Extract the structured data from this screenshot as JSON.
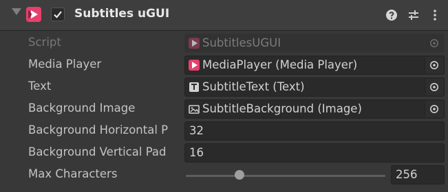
{
  "component": {
    "title": "Subtitles uGUI",
    "enabled": true,
    "icons": {
      "component": "avpro-play-icon",
      "help": "help-icon",
      "presets": "presets-sliders-icon",
      "menu": "kebab-menu-icon"
    },
    "colors": {
      "brand": "#e73f6c",
      "accent": "#e8e8e8"
    }
  },
  "fields": {
    "script": {
      "label": "Script",
      "value": "SubtitlesUGUI",
      "icon": "script-icon"
    },
    "media_player": {
      "label": "Media Player",
      "value": "MediaPlayer (Media Player)",
      "icon": "avpro-play-icon"
    },
    "text": {
      "label": "Text",
      "value": "SubtitleText (Text)",
      "icon": "text-component-icon"
    },
    "background_image": {
      "label": "Background Image",
      "value": "SubtitleBackground (Image)",
      "icon": "image-component-icon"
    },
    "bg_horizontal_padding": {
      "label": "Background Horizontal P",
      "value": "32"
    },
    "bg_vertical_padding": {
      "label": "Background Vertical Pad",
      "value": "16"
    },
    "max_characters": {
      "label": "Max Characters",
      "value": "256",
      "slider_fraction": 0.27
    }
  }
}
